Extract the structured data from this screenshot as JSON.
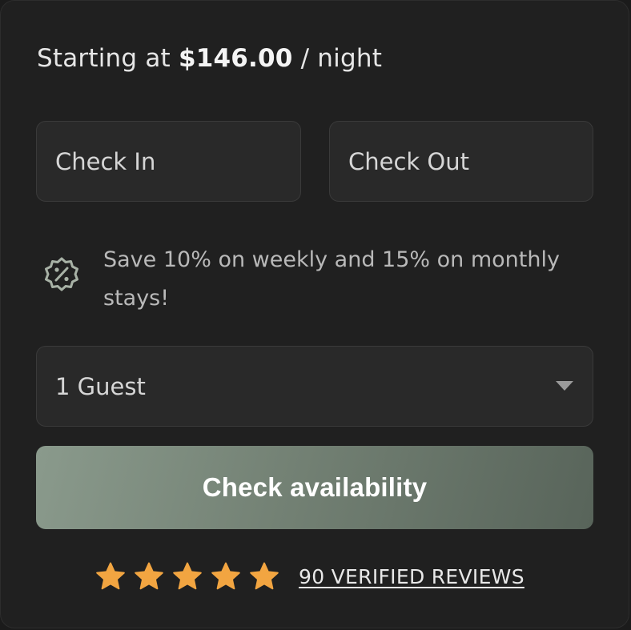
{
  "pricing": {
    "prefix": "Starting at",
    "amount": "$146.00",
    "suffix": "/ night"
  },
  "dates": {
    "check_in_label": "Check In",
    "check_out_label": "Check Out"
  },
  "promo": {
    "icon": "discount-badge-icon",
    "text": "Save 10% on weekly and 15% on monthly stays!"
  },
  "guests": {
    "selected": "1 Guest"
  },
  "cta": {
    "label": "Check availability"
  },
  "reviews": {
    "rating": 5,
    "max_rating": 5,
    "label": "90 VERIFIED REVIEWS"
  },
  "colors": {
    "card_background": "#202020",
    "field_background": "#292929",
    "button_gradient_start": "#8a9a8c",
    "button_gradient_end": "#58645a",
    "star": "#f2a541"
  }
}
